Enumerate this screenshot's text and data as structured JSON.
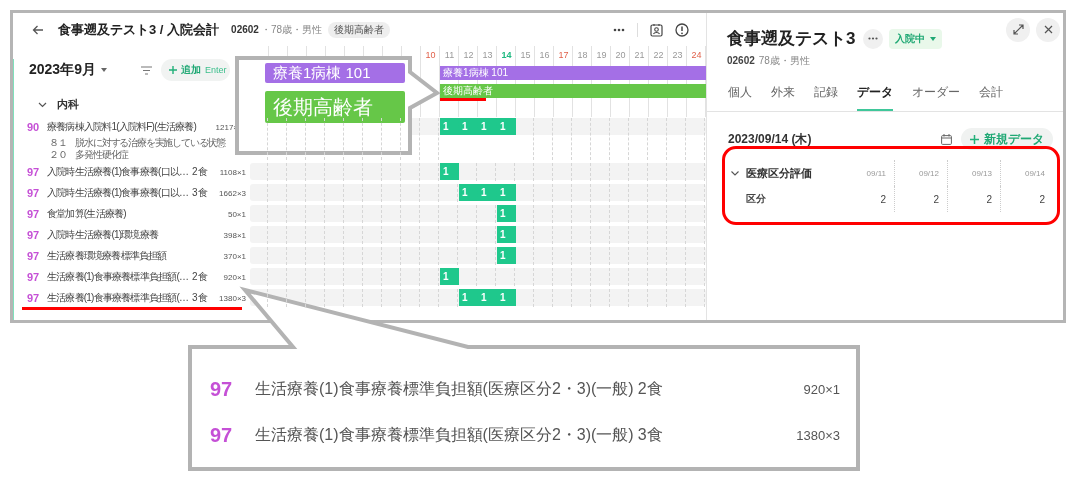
{
  "header": {
    "title": "食事遡及テスト3 / 入院会計",
    "patient_id": "02602",
    "demographics": "・78歳・男性",
    "tag": "後期高齢者"
  },
  "toolbar": {
    "month": "2023年9月",
    "add_label": "追加",
    "add_shortcut": "Enter"
  },
  "group": {
    "label": "内科",
    "expanded": true
  },
  "days": [
    {
      "label": "10",
      "holiday": true,
      "today": false
    },
    {
      "label": "11",
      "holiday": false,
      "today": false
    },
    {
      "label": "12",
      "holiday": false,
      "today": false
    },
    {
      "label": "13",
      "holiday": false,
      "today": false
    },
    {
      "label": "14",
      "holiday": false,
      "today": true
    },
    {
      "label": "15",
      "holiday": false,
      "today": false
    },
    {
      "label": "16",
      "holiday": false,
      "today": false
    },
    {
      "label": "17",
      "holiday": true,
      "today": false
    },
    {
      "label": "18",
      "holiday": false,
      "today": false
    },
    {
      "label": "19",
      "holiday": false,
      "today": false
    },
    {
      "label": "20",
      "holiday": false,
      "today": false
    },
    {
      "label": "21",
      "holiday": false,
      "today": false
    },
    {
      "label": "22",
      "holiday": false,
      "today": false
    },
    {
      "label": "23",
      "holiday": false,
      "today": false
    },
    {
      "label": "24",
      "holiday": true,
      "today": false
    }
  ],
  "bands": [
    {
      "label": "療養1病棟 101",
      "color": "#a46fe6"
    },
    {
      "label": "後期高齢者",
      "color": "#66c748"
    }
  ],
  "rows": [
    {
      "code": "90",
      "name": "療養病棟入院料1(入院料F)(生活療養)",
      "amount": "1217×",
      "notes": [
        "８１　脱水に対する治療を実施している状態",
        "２０　多発性硬化症"
      ],
      "cells": [
        {
          "filled": false
        },
        {
          "filled": true,
          "value": "1"
        },
        {
          "filled": true,
          "value": "1"
        },
        {
          "filled": true,
          "value": "1"
        },
        {
          "filled": true,
          "value": "1"
        },
        {
          "filled": false
        },
        {
          "filled": false
        },
        {
          "filled": false
        },
        {
          "filled": false
        },
        {
          "filled": false
        },
        {
          "filled": false
        },
        {
          "filled": false
        },
        {
          "filled": false
        },
        {
          "filled": false
        },
        {
          "filled": false
        }
      ]
    },
    {
      "code": "97",
      "name": "入院時生活療養(1)食事療養(口以…",
      "meals": "2食",
      "amount": "1108×1",
      "cells": [
        {
          "filled": false
        },
        {
          "filled": true,
          "value": "1"
        },
        {
          "filled": false
        },
        {
          "filled": false
        },
        {
          "filled": false
        },
        {
          "filled": false
        },
        {
          "filled": false
        },
        {
          "filled": false
        },
        {
          "filled": false
        },
        {
          "filled": false
        },
        {
          "filled": false
        },
        {
          "filled": false
        },
        {
          "filled": false
        },
        {
          "filled": false
        },
        {
          "filled": false
        }
      ]
    },
    {
      "code": "97",
      "name": "入院時生活療養(1)食事療養(口以…",
      "meals": "3食",
      "amount": "1662×3",
      "cells": [
        {
          "filled": false
        },
        {
          "filled": false
        },
        {
          "filled": true,
          "value": "1"
        },
        {
          "filled": true,
          "value": "1"
        },
        {
          "filled": true,
          "value": "1"
        },
        {
          "filled": false
        },
        {
          "filled": false
        },
        {
          "filled": false
        },
        {
          "filled": false
        },
        {
          "filled": false
        },
        {
          "filled": false
        },
        {
          "filled": false
        },
        {
          "filled": false
        },
        {
          "filled": false
        },
        {
          "filled": false
        }
      ]
    },
    {
      "code": "97",
      "name": "食堂加算(生活療養)",
      "amount": "50×1",
      "cells": [
        {
          "filled": false
        },
        {
          "filled": false
        },
        {
          "filled": false
        },
        {
          "filled": false
        },
        {
          "filled": true,
          "value": "1"
        },
        {
          "filled": false
        },
        {
          "filled": false
        },
        {
          "filled": false
        },
        {
          "filled": false
        },
        {
          "filled": false
        },
        {
          "filled": false
        },
        {
          "filled": false
        },
        {
          "filled": false
        },
        {
          "filled": false
        },
        {
          "filled": false
        }
      ]
    },
    {
      "code": "97",
      "name": "入院時生活療養(1)環境療養",
      "amount": "398×1",
      "cells": [
        {
          "filled": false
        },
        {
          "filled": false
        },
        {
          "filled": false
        },
        {
          "filled": false
        },
        {
          "filled": true,
          "value": "1"
        },
        {
          "filled": false
        },
        {
          "filled": false
        },
        {
          "filled": false
        },
        {
          "filled": false
        },
        {
          "filled": false
        },
        {
          "filled": false
        },
        {
          "filled": false
        },
        {
          "filled": false
        },
        {
          "filled": false
        },
        {
          "filled": false
        }
      ]
    },
    {
      "code": "97",
      "name": "生活療養環境療養標準負担額",
      "amount": "370×1",
      "cells": [
        {
          "filled": false
        },
        {
          "filled": false
        },
        {
          "filled": false
        },
        {
          "filled": false
        },
        {
          "filled": true,
          "value": "1"
        },
        {
          "filled": false
        },
        {
          "filled": false
        },
        {
          "filled": false
        },
        {
          "filled": false
        },
        {
          "filled": false
        },
        {
          "filled": false
        },
        {
          "filled": false
        },
        {
          "filled": false
        },
        {
          "filled": false
        },
        {
          "filled": false
        }
      ]
    },
    {
      "code": "97",
      "name": "生活療養(1)食事療養標準負担額(…",
      "meals": "2食",
      "amount": "920×1",
      "cells": [
        {
          "filled": false
        },
        {
          "filled": true,
          "value": "1"
        },
        {
          "filled": false
        },
        {
          "filled": false
        },
        {
          "filled": false
        },
        {
          "filled": false
        },
        {
          "filled": false
        },
        {
          "filled": false
        },
        {
          "filled": false
        },
        {
          "filled": false
        },
        {
          "filled": false
        },
        {
          "filled": false
        },
        {
          "filled": false
        },
        {
          "filled": false
        },
        {
          "filled": false
        }
      ]
    },
    {
      "code": "97",
      "name": "生活療養(1)食事療養標準負担額(…",
      "meals": "3食",
      "amount": "1380×3",
      "cells": [
        {
          "filled": false
        },
        {
          "filled": false
        },
        {
          "filled": true,
          "value": "1"
        },
        {
          "filled": true,
          "value": "1"
        },
        {
          "filled": true,
          "value": "1"
        },
        {
          "filled": false
        },
        {
          "filled": false
        },
        {
          "filled": false
        },
        {
          "filled": false
        },
        {
          "filled": false
        },
        {
          "filled": false
        },
        {
          "filled": false
        },
        {
          "filled": false
        },
        {
          "filled": false
        },
        {
          "filled": false
        }
      ]
    }
  ],
  "detail": {
    "name": "食事遡及テスト3",
    "status": "入院中",
    "patient_id": "02602",
    "demographics": "78歳・男性",
    "tabs": [
      {
        "label": "個人",
        "selected": false
      },
      {
        "label": "外来",
        "selected": false
      },
      {
        "label": "記録",
        "selected": false
      },
      {
        "label": "データ",
        "selected": true
      },
      {
        "label": "オーダー",
        "selected": false
      },
      {
        "label": "会計",
        "selected": false
      }
    ],
    "date": "2023/09/14 (木)",
    "new_button": "新規データ",
    "section": {
      "title": "医療区分評価",
      "expanded": true,
      "dates": [
        "09/11",
        "09/12",
        "09/13",
        "09/14"
      ],
      "rows": [
        {
          "label": "区分",
          "values": [
            "2",
            "2",
            "2",
            "2"
          ]
        }
      ]
    }
  },
  "callout_bands": [
    {
      "label": "療養1病棟 101",
      "color": "#a46fe6"
    },
    {
      "label": "後期高齢者",
      "color": "#66c748"
    }
  ],
  "callout_rows": [
    {
      "code": "97",
      "name": "生活療養(1)食事療養標準負担額(医療区分2・3)(一般)",
      "meals": "2食",
      "amount": "920×1"
    },
    {
      "code": "97",
      "name": "生活療養(1)食事療養標準負担額(医療区分2・3)(一般)",
      "meals": "3食",
      "amount": "1380×3"
    }
  ]
}
